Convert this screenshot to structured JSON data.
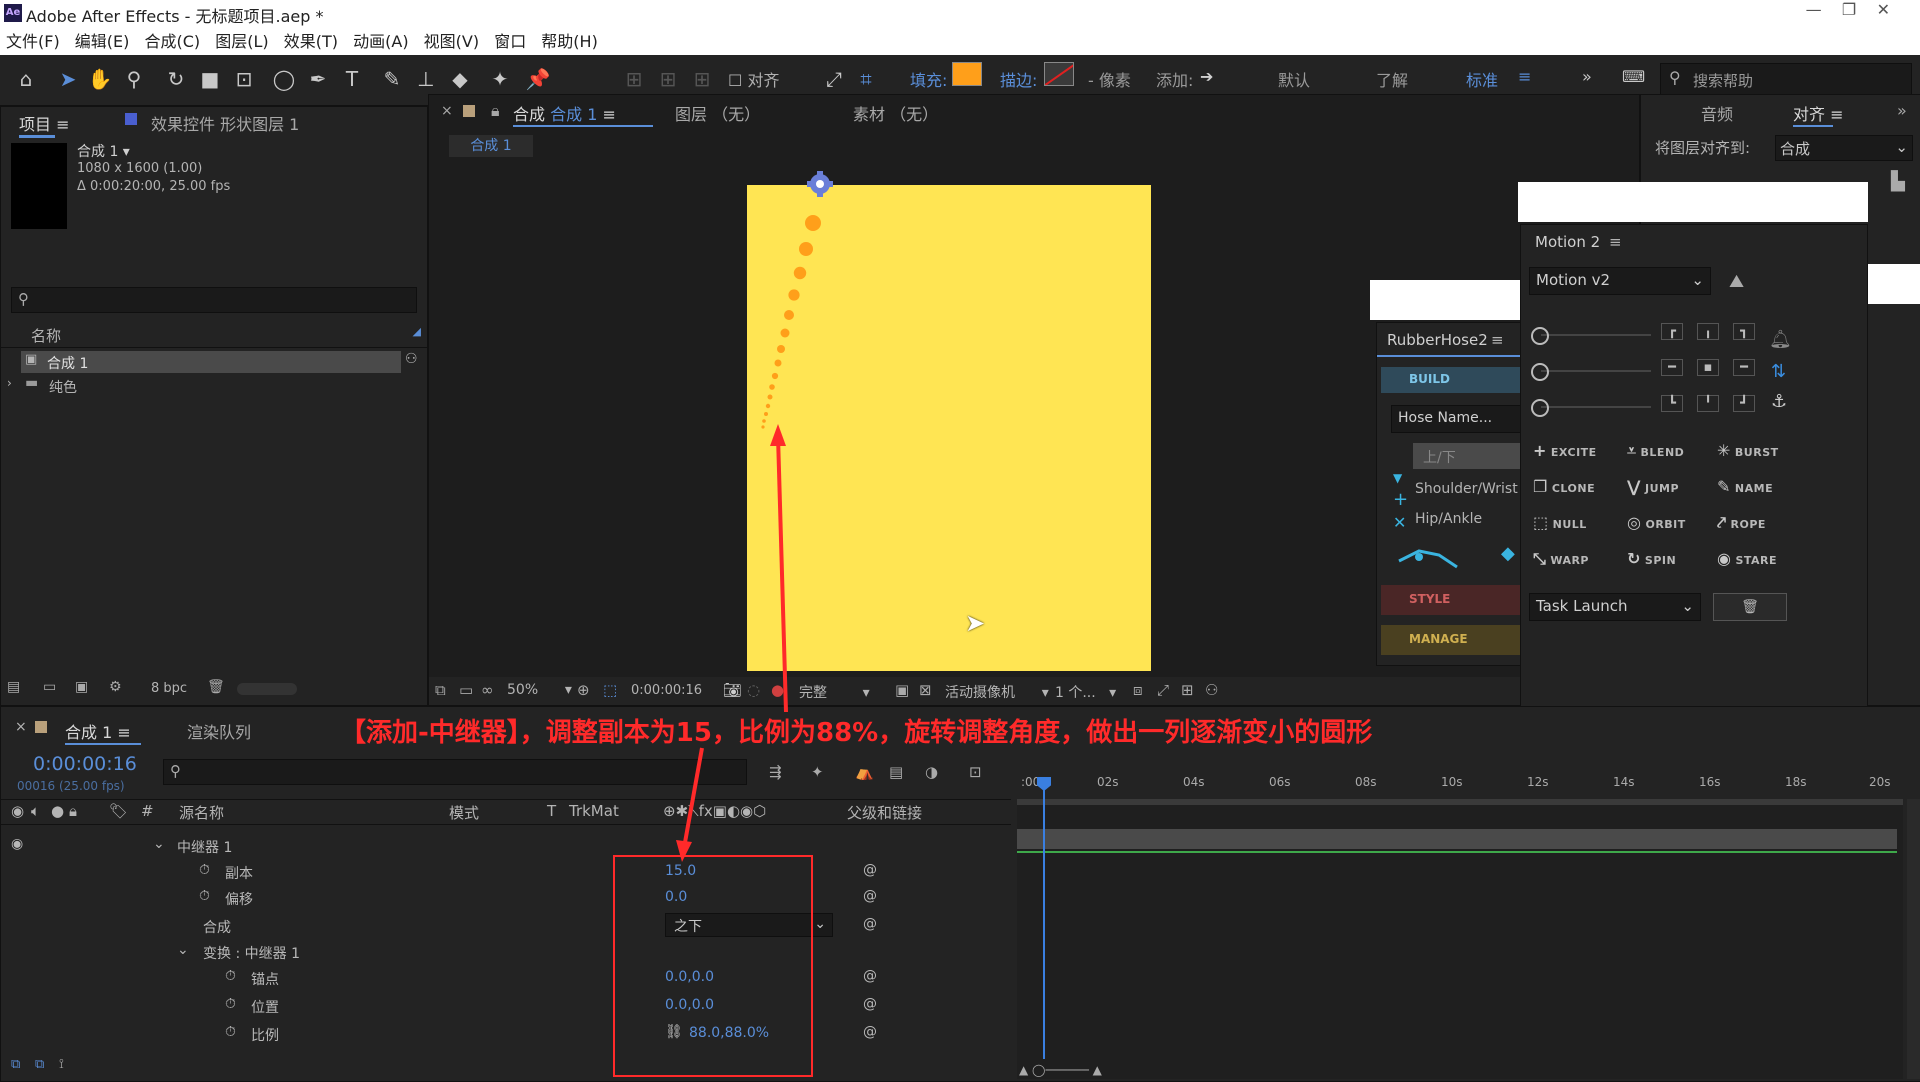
{
  "window": {
    "title": "Adobe After Effects - 无标题项目.aep *"
  },
  "menu": [
    "文件(F)",
    "编辑(E)",
    "合成(C)",
    "图层(L)",
    "效果(T)",
    "动画(A)",
    "视图(V)",
    "窗口",
    "帮助(H)"
  ],
  "toolbar": {
    "align_label": "对齐",
    "fill_label": "填充:",
    "fill_color": "#ff9f1a",
    "stroke_label": "描边:",
    "stroke_unit": "- 像素",
    "add_label": "添加:",
    "workspace_default": "默认",
    "workspace_learn": "了解",
    "workspace_standard": "标准",
    "search_placeholder": "搜索帮助"
  },
  "project_panel": {
    "tab_project": "项目",
    "tab_effects": "效果控件 形状图层 1",
    "comp_name": "合成 1",
    "comp_size": "1080 x 1600 (1.00)",
    "comp_duration": "Δ 0:00:20:00, 25.00 fps",
    "col_name": "名称",
    "items": [
      "合成 1",
      "纯色"
    ],
    "bpc": "8 bpc"
  },
  "comp_viewer": {
    "tab_comp": "合成",
    "tab_comp_name": "合成 1",
    "tab_layer": "图层 （无）",
    "tab_footage": "素材 （无）",
    "subtab": "合成 1",
    "zoom": "50%",
    "timecode": "0:00:00:16",
    "resolution": "完整",
    "camera": "活动摄像机",
    "views": "1 个...",
    "canvas_color": "#ffe553",
    "dot_color": "#ff9f1a"
  },
  "right_panel": {
    "tab_audio": "音频",
    "tab_align": "对齐",
    "align_to_label": "将图层对齐到:",
    "align_to_value": "合成"
  },
  "rubberhose": {
    "title": "RubberHose2",
    "build": "BUILD",
    "hose_name": "Hose Name...",
    "updown": "上/下",
    "shoulder": "Shoulder/Wrist",
    "hip": "Hip/Ankle",
    "style": "STYLE",
    "manage": "MANAGE"
  },
  "motion": {
    "title": "Motion 2",
    "dropdown": "Motion v2",
    "buttons": [
      "EXCITE",
      "BLEND",
      "BURST",
      "CLONE",
      "JUMP",
      "NAME",
      "NULL",
      "ORBIT",
      "ROPE",
      "WARP",
      "SPIN",
      "STARE"
    ],
    "task": "Task Launch"
  },
  "timeline": {
    "tab_comp": "合成 1",
    "tab_render": "渲染队列",
    "timecode": "0:00:00:16",
    "frames": "00016 (25.00 fps)",
    "col_source": "源名称",
    "col_mode": "模式",
    "col_t": "T",
    "col_trkmat": "TrkMat",
    "col_parent": "父级和链接",
    "ruler": [
      ":00s",
      "02s",
      "04s",
      "06s",
      "08s",
      "10s",
      "12s",
      "14s",
      "16s",
      "18s",
      "20s"
    ],
    "rows": {
      "repeater": "中继器 1",
      "copies_label": "副本",
      "copies_value": "15.0",
      "offset_label": "偏移",
      "offset_value": "0.0",
      "composite_label": "合成",
      "composite_value": "之下",
      "transform_label": "变换 : 中继器 1",
      "anchor_label": "锚点",
      "anchor_value": "0.0,0.0",
      "position_label": "位置",
      "position_value": "0.0,0.0",
      "scale_label": "比例",
      "scale_value": "88.0,88.0%"
    }
  },
  "annotation": {
    "caption": "【添加-中继器】，调整副本为15，比例为88%，旋转调整角度，做出一列逐渐变小的圆形",
    "color": "#ff2a2a"
  }
}
